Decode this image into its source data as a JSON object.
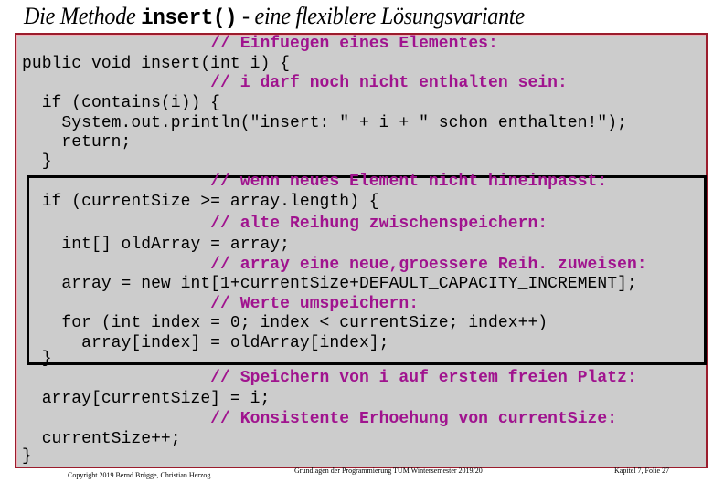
{
  "title": {
    "prefix": "Die Methode ",
    "code": "insert()",
    "suffix": " - eine flexiblere Lösungsvariante"
  },
  "code_lines": [
    {
      "text": "                   // Einfuegen eines Elementes:",
      "kind": "comment"
    },
    {
      "text": "public void insert(int i) {",
      "kind": "code"
    },
    {
      "text": "                   // i darf noch nicht enthalten sein:",
      "kind": "comment"
    },
    {
      "text": "  if (contains(i)) {",
      "kind": "code"
    },
    {
      "text": "    System.out.println(\"insert: \" + i + \" schon enthalten!\");",
      "kind": "code"
    },
    {
      "text": "    return;",
      "kind": "code"
    },
    {
      "text": "  }",
      "kind": "code"
    },
    {
      "text": "                   // wenn neues Element nicht hineinpasst:",
      "kind": "comment"
    },
    {
      "text": "  if (currentSize >= array.length) {",
      "kind": "code"
    },
    {
      "text": "                   // alte Reihung zwischenspeichern:",
      "kind": "comment"
    },
    {
      "text": "    int[] oldArray = array;",
      "kind": "code"
    },
    {
      "text": "                   // array eine neue,groessere Reih. zuweisen:",
      "kind": "comment"
    },
    {
      "text": "    array = new int[1+currentSize+DEFAULT_CAPACITY_INCREMENT];",
      "kind": "code"
    },
    {
      "text": "                   // Werte umspeichern:",
      "kind": "comment"
    },
    {
      "text": "    for (int index = 0; index < currentSize; index++)",
      "kind": "code"
    },
    {
      "text": "      array[index] = oldArray[index];",
      "kind": "code"
    },
    {
      "text": "  }",
      "kind": "code"
    },
    {
      "text": "                   // Speichern von i auf erstem freien Platz:",
      "kind": "comment"
    },
    {
      "text": "  array[currentSize] = i;",
      "kind": "code"
    },
    {
      "text": "                   // Konsistente Erhoehung von currentSize:",
      "kind": "comment"
    },
    {
      "text": "  currentSize++;",
      "kind": "code"
    },
    {
      "text": "}",
      "kind": "code"
    }
  ],
  "footer": {
    "copyright": "Copyright 2019 Bernd Brügge, Christian Herzog",
    "course": "Grundlagen der Programmierung  TUM Wintersemester 2019/20",
    "page": "Kapitel 7, Folie 27"
  },
  "colors": {
    "comment": "#a0138e",
    "code_background": "#cccccc",
    "frame_border": "#9b1c2c",
    "highlight_border": "#000000"
  }
}
